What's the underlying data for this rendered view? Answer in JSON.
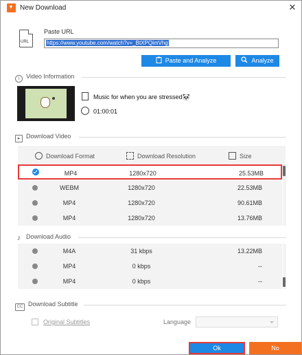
{
  "window": {
    "title": "New Download",
    "close_glyph": "✕"
  },
  "url": {
    "label": "Paste URL",
    "value": "https://www.youtube.com/watch?v=_BtXPQimVhg",
    "icon_text": "URL"
  },
  "buttons": {
    "paste_analyze": "Paste and Analyze",
    "analyze": "Analyze",
    "ok": "Ok",
    "no": "No"
  },
  "video_info": {
    "header": "Video Information",
    "title": "Music for when you are stressed🐼",
    "duration": "01:00:01"
  },
  "download_video": {
    "header": "Download Video",
    "columns": [
      "Download Format",
      "Download Resolution",
      "Size"
    ],
    "rows": [
      {
        "format": "MP4",
        "resolution": "1280x720",
        "size": "25.53MB",
        "selected": true
      },
      {
        "format": "WEBM",
        "resolution": "1280x720",
        "size": "22.53MB",
        "selected": false
      },
      {
        "format": "MP4",
        "resolution": "1280x720",
        "size": "90.61MB",
        "selected": false
      },
      {
        "format": "MP4",
        "resolution": "1280x720",
        "size": "13.76MB",
        "selected": false
      }
    ]
  },
  "download_audio": {
    "header": "Download Audio",
    "rows": [
      {
        "format": "M4A",
        "bitrate": "31 kbps",
        "size": "13.22MB"
      },
      {
        "format": "MP4",
        "bitrate": "0 kbps",
        "size": "--"
      },
      {
        "format": "MP4",
        "bitrate": "0 kbps",
        "size": "--"
      }
    ]
  },
  "download_subtitle": {
    "header": "Download Subtitle",
    "original_label": "Original Subtitles",
    "language_label": "Language",
    "language_value": ""
  },
  "colors": {
    "accent_blue": "#1e88e5",
    "accent_orange": "#f37021",
    "highlight_red": "#e53935"
  }
}
